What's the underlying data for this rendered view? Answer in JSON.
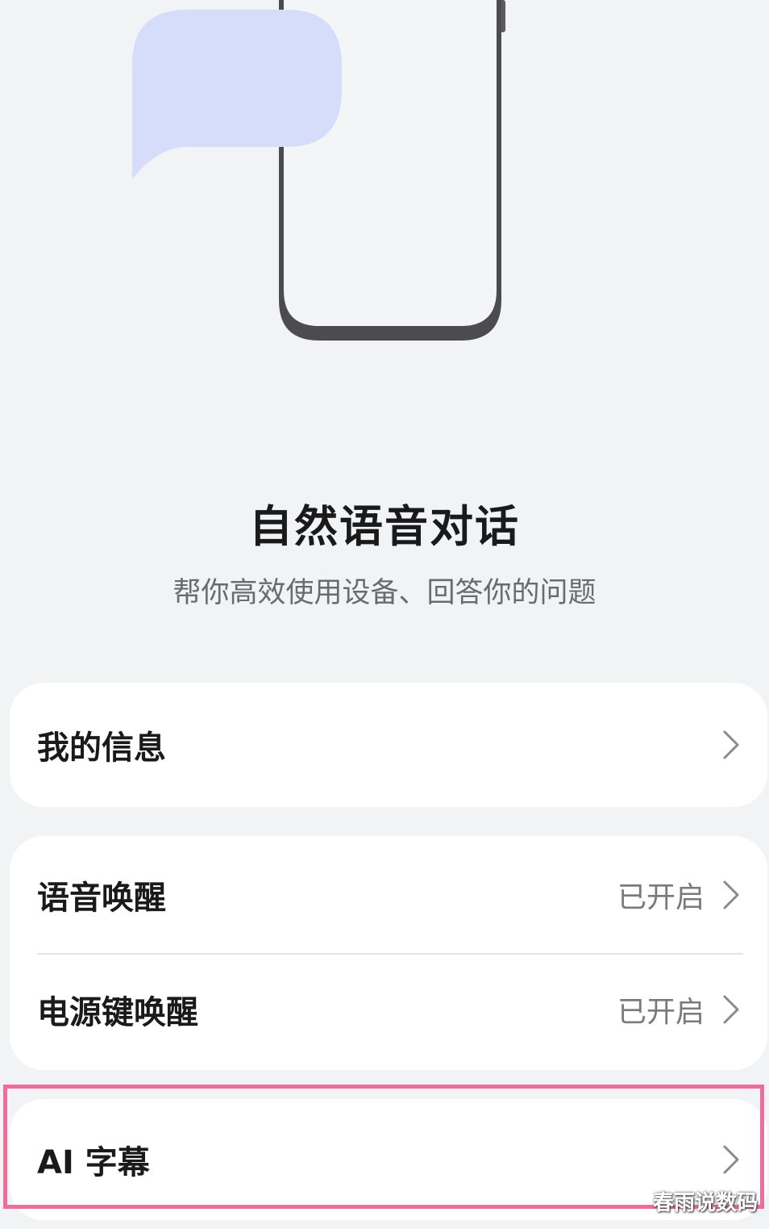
{
  "hero": {
    "title": "自然语音对话",
    "subtitle": "帮你高效使用设备、回答你的问题"
  },
  "settings": {
    "my_info": {
      "label": "我的信息"
    },
    "voice_wake": {
      "label": "语音唤醒",
      "status": "已开启"
    },
    "power_key_wake": {
      "label": "电源键唤醒",
      "status": "已开启"
    },
    "ai_subtitles": {
      "label": "AI 字幕"
    }
  },
  "icons": {
    "chevron": "chevron-right-icon"
  },
  "colors": {
    "background": "#f1f3f5",
    "card": "#ffffff",
    "highlight": "#f06c9b",
    "bubble": "#d6ddfb"
  },
  "watermark": "春雨说数码"
}
